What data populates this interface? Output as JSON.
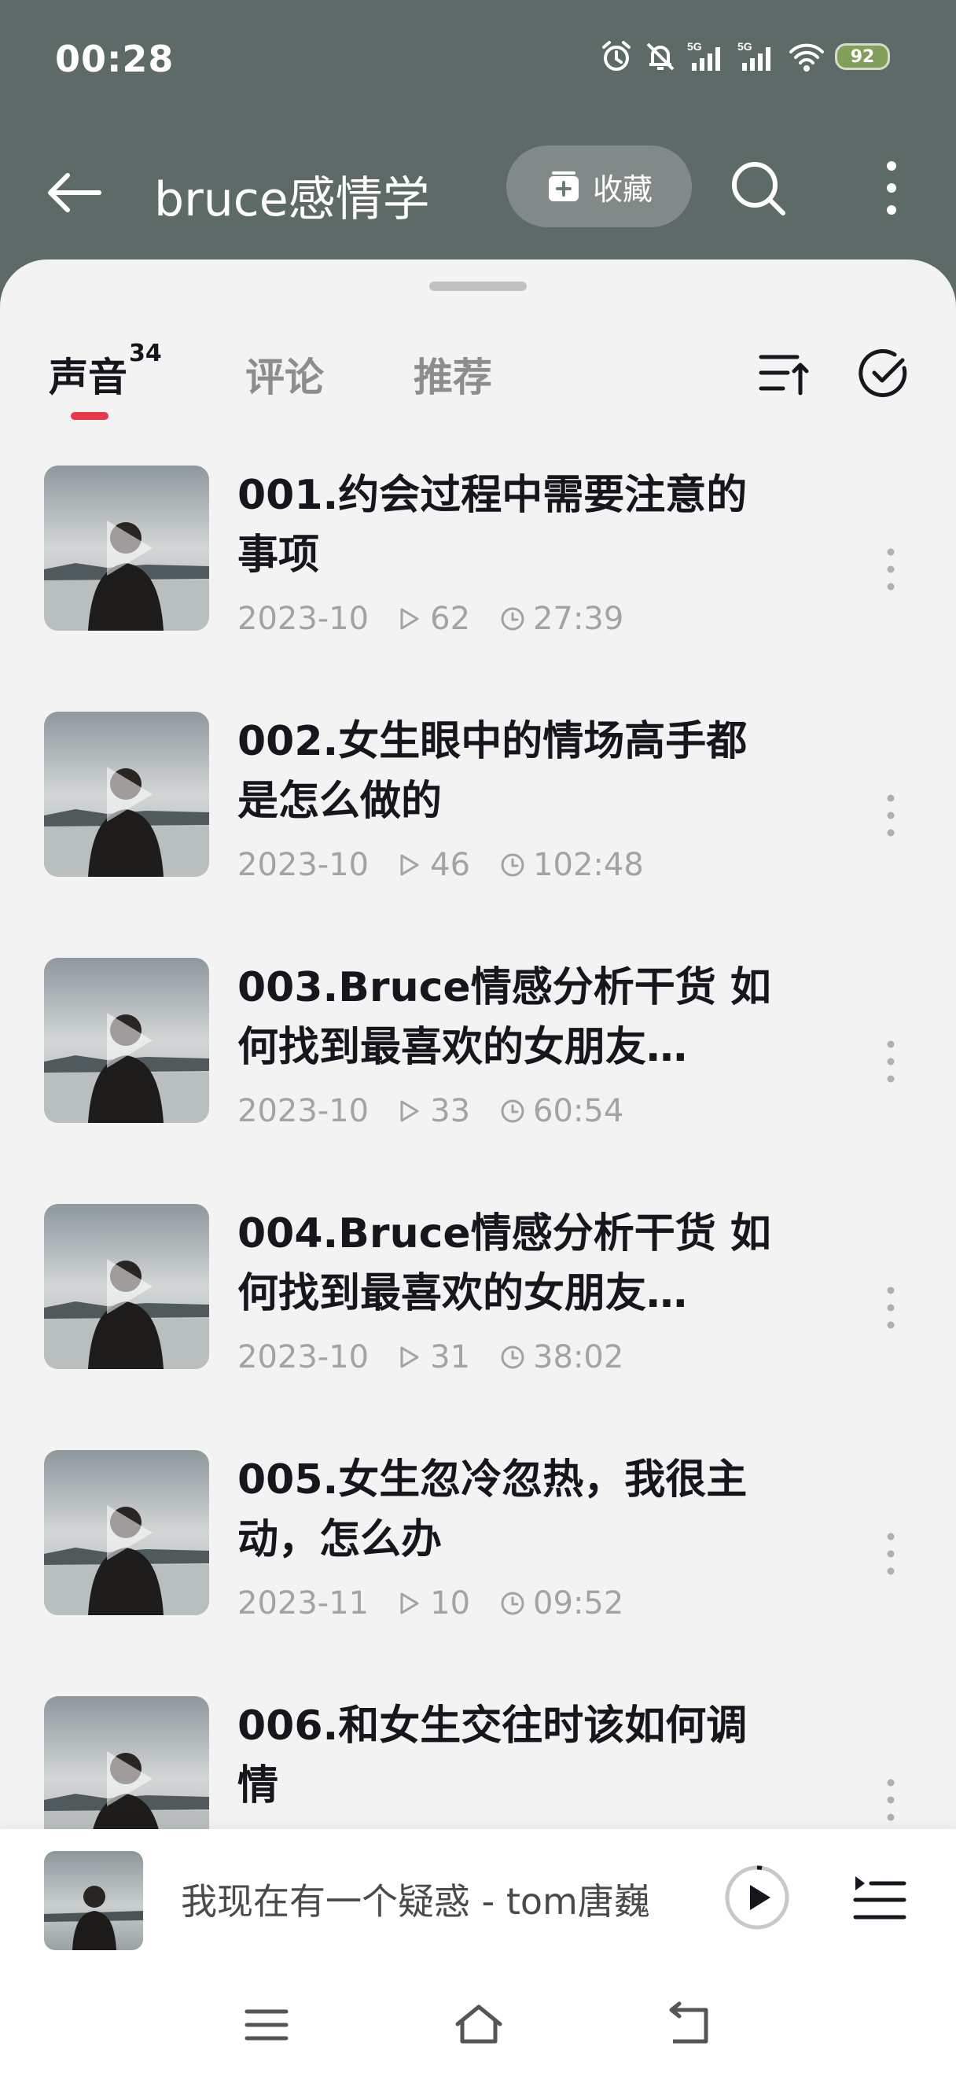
{
  "status_bar": {
    "time": "00:28",
    "battery": "92",
    "signal1_label": "5G",
    "signal2_label": "5G"
  },
  "app_bar": {
    "title": "bruce感情学",
    "favorite_label": "收藏"
  },
  "tabs": [
    {
      "label": "声音",
      "badge": "34"
    },
    {
      "label": "评论"
    },
    {
      "label": "推荐"
    }
  ],
  "tracks": [
    {
      "title": "001.约会过程中需要注意的事项",
      "date": "2023-10",
      "plays": "62",
      "duration": "27:39"
    },
    {
      "title": "002.女生眼中的情场高手都是怎么做的",
      "date": "2023-10",
      "plays": "46",
      "duration": "102:48"
    },
    {
      "title": "003.Bruce情感分析干货 如何找到最喜欢的女朋友…",
      "date": "2023-10",
      "plays": "33",
      "duration": "60:54"
    },
    {
      "title": "004.Bruce情感分析干货 如何找到最喜欢的女朋友…",
      "date": "2023-10",
      "plays": "31",
      "duration": "38:02"
    },
    {
      "title": "005.女生忽冷忽热，我很主动，怎么办",
      "date": "2023-11",
      "plays": "10",
      "duration": "09:52"
    },
    {
      "title": "006.和女生交往时该如何调情",
      "date": "",
      "plays": "",
      "duration": ""
    }
  ],
  "mini_player": {
    "now_playing": "我现在有一个疑惑 - tom唐巍"
  },
  "colors": {
    "header_bg": "#5e6a68",
    "sheet_bg": "#f3f3f3",
    "accent": "#e8394c"
  }
}
